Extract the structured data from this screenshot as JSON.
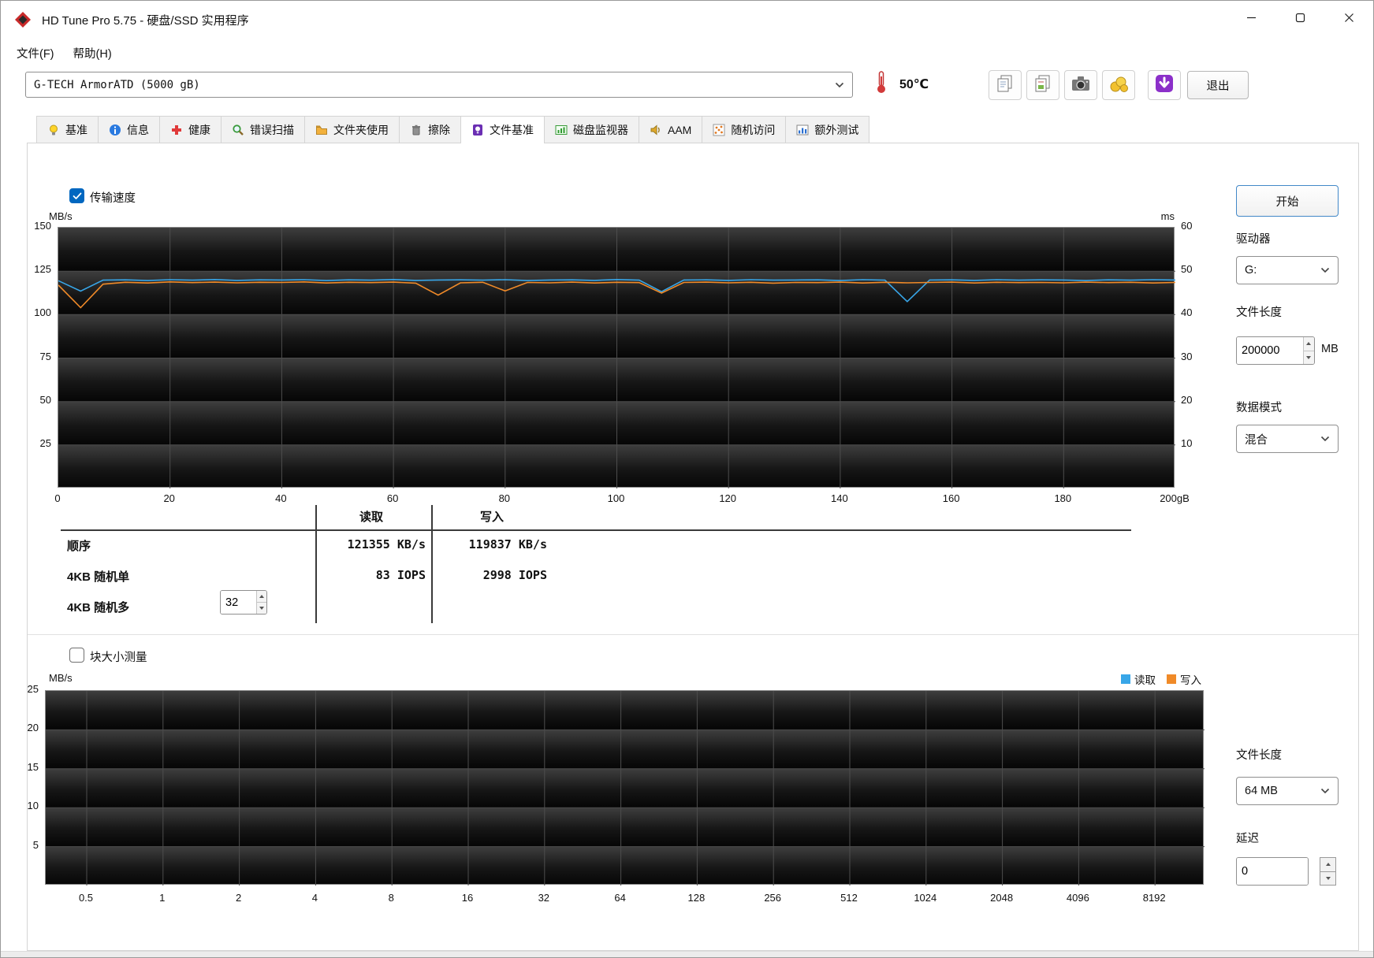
{
  "window": {
    "title": "HD Tune Pro 5.75 - 硬盘/SSD 实用程序",
    "controls": [
      {
        "name": "minimize-button",
        "icon": "minimize-icon"
      },
      {
        "name": "maximize-button",
        "icon": "maximize-icon"
      },
      {
        "name": "close-button",
        "icon": "close-icon"
      }
    ]
  },
  "menu": {
    "items": [
      {
        "name": "file",
        "label": "文件(F)"
      },
      {
        "name": "help",
        "label": "帮助(H)"
      }
    ]
  },
  "toolbar": {
    "drive_select": "G-TECH  ArmorATD (5000 gB)",
    "temperature": "50℃",
    "exit_label": "退出",
    "buttons": [
      {
        "name": "copy-results-button",
        "icon": "copy-icon"
      },
      {
        "name": "copy-image-button",
        "icon": "copy-image-icon"
      },
      {
        "name": "screenshot-button",
        "icon": "camera-icon"
      },
      {
        "name": "donate-button",
        "icon": "coins-icon"
      },
      {
        "name": "update-button",
        "icon": "download-arrow-icon"
      }
    ]
  },
  "tabs": [
    {
      "name": "benchmark",
      "label": "基准",
      "icon": "bulb-icon",
      "active": false
    },
    {
      "name": "info",
      "label": "信息",
      "icon": "info-icon",
      "active": false
    },
    {
      "name": "health",
      "label": "健康",
      "icon": "health-icon",
      "active": false
    },
    {
      "name": "error-scan",
      "label": "错误扫描",
      "icon": "scan-icon",
      "active": false
    },
    {
      "name": "folder-usage",
      "label": "文件夹使用",
      "icon": "folder-icon",
      "active": false
    },
    {
      "name": "erase",
      "label": "擦除",
      "icon": "erase-icon",
      "active": false
    },
    {
      "name": "file-benchmark",
      "label": "文件基准",
      "icon": "filebench-icon",
      "active": true
    },
    {
      "name": "disk-monitor",
      "label": "磁盘监视器",
      "icon": "monitor-icon",
      "active": false
    },
    {
      "name": "aam",
      "label": "AAM",
      "icon": "aam-icon",
      "active": false
    },
    {
      "name": "random-access",
      "label": "随机访问",
      "icon": "random-icon",
      "active": false
    },
    {
      "name": "extra-tests",
      "label": "额外测试",
      "icon": "extra-icon",
      "active": false
    }
  ],
  "file_benchmark": {
    "transfer_speed_label": "传输速度",
    "start_button": "开始",
    "drive_label": "驱动器",
    "drive_value": "G:",
    "file_length_label": "文件长度",
    "file_length_value": "200000",
    "file_length_unit": "MB",
    "data_mode_label": "数据模式",
    "data_mode_value": "混合",
    "stats": {
      "col_read": "读取",
      "col_write": "写入",
      "queue_depth": "32",
      "rows": [
        {
          "label": "顺序",
          "read": "121355 KB/s",
          "write": "119837 KB/s"
        },
        {
          "label": "4KB 随机单",
          "read": "83 IOPS",
          "write": "2998 IOPS"
        },
        {
          "label": "4KB 随机多",
          "read": "",
          "write": ""
        }
      ]
    }
  },
  "block_size": {
    "label": "块大小测量",
    "legend": [
      {
        "name": "read",
        "label": "读取",
        "color": "#38a6e8"
      },
      {
        "name": "write",
        "label": "写入",
        "color": "#f08a28"
      }
    ],
    "file_length_label": "文件长度",
    "file_length_value": "64 MB",
    "delay_label": "延迟",
    "delay_value": "0"
  },
  "chart_data": [
    {
      "type": "line",
      "title": "传输速度",
      "xlabel": "gB",
      "xlim": [
        0,
        200
      ],
      "x_tick_values": [
        0,
        20,
        40,
        60,
        80,
        100,
        120,
        140,
        160,
        180,
        200
      ],
      "x_tick_labels": [
        "0",
        "20",
        "40",
        "60",
        "80",
        "100",
        "120",
        "140",
        "160",
        "180",
        "200gB"
      ],
      "ylim": [
        0,
        150
      ],
      "y_left_label": "MB/s",
      "y_left_ticks": [
        25,
        50,
        75,
        100,
        125,
        150
      ],
      "y_right_label": "ms",
      "y_right_max": 60,
      "y_right_ticks": [
        10,
        20,
        30,
        40,
        50,
        60
      ],
      "grid": true,
      "legend_position": "none",
      "x_step": 4,
      "series": [
        {
          "name": "读取",
          "color": "#38a6e8",
          "values": [
            119.5,
            113.5,
            119.8,
            120,
            119.6,
            120.1,
            119.8,
            120.2,
            119.7,
            120,
            119.9,
            120.1,
            119.6,
            120,
            119.8,
            120.2,
            119.7,
            119.9,
            120,
            119.8,
            120.1,
            119.6,
            119.9,
            120,
            119.7,
            120.2,
            119.8,
            113.2,
            119.9,
            120,
            119.7,
            120.1,
            119.8,
            119.9,
            120,
            119.6,
            120.1,
            119.8,
            107.5,
            119.9,
            120,
            119.7,
            120.1,
            119.8,
            120,
            119.9,
            119.6,
            120,
            119.8,
            120.1,
            119.9
          ]
        },
        {
          "name": "写入",
          "color": "#f08a28",
          "values": [
            117,
            104,
            117.5,
            118.6,
            118.2,
            118.8,
            118.4,
            118.7,
            118.3,
            118.6,
            118.5,
            118.8,
            118.2,
            118.6,
            118.4,
            118.7,
            118.1,
            111.2,
            118.3,
            118.6,
            113.6,
            118.5,
            118.3,
            118.7,
            118.2,
            118.6,
            118.4,
            112.4,
            118.5,
            118.7,
            118.3,
            118.6,
            118.1,
            118.5,
            118.4,
            118.7,
            118.2,
            118.6,
            118.3,
            118.5,
            118.7,
            118.2,
            118.6,
            118.4,
            118.5,
            118.3,
            118.7,
            118.4,
            118.6,
            118.2,
            118.5
          ]
        }
      ]
    },
    {
      "type": "line",
      "title": "块大小测量",
      "categories": [
        "0.5",
        "1",
        "2",
        "4",
        "8",
        "16",
        "32",
        "64",
        "128",
        "256",
        "512",
        "1024",
        "2048",
        "4096",
        "8192"
      ],
      "ylim": [
        0,
        25
      ],
      "y_left_label": "MB/s",
      "y_left_ticks": [
        5,
        10,
        15,
        20,
        25
      ],
      "grid": true,
      "legend_position": "top-right",
      "series": []
    }
  ]
}
